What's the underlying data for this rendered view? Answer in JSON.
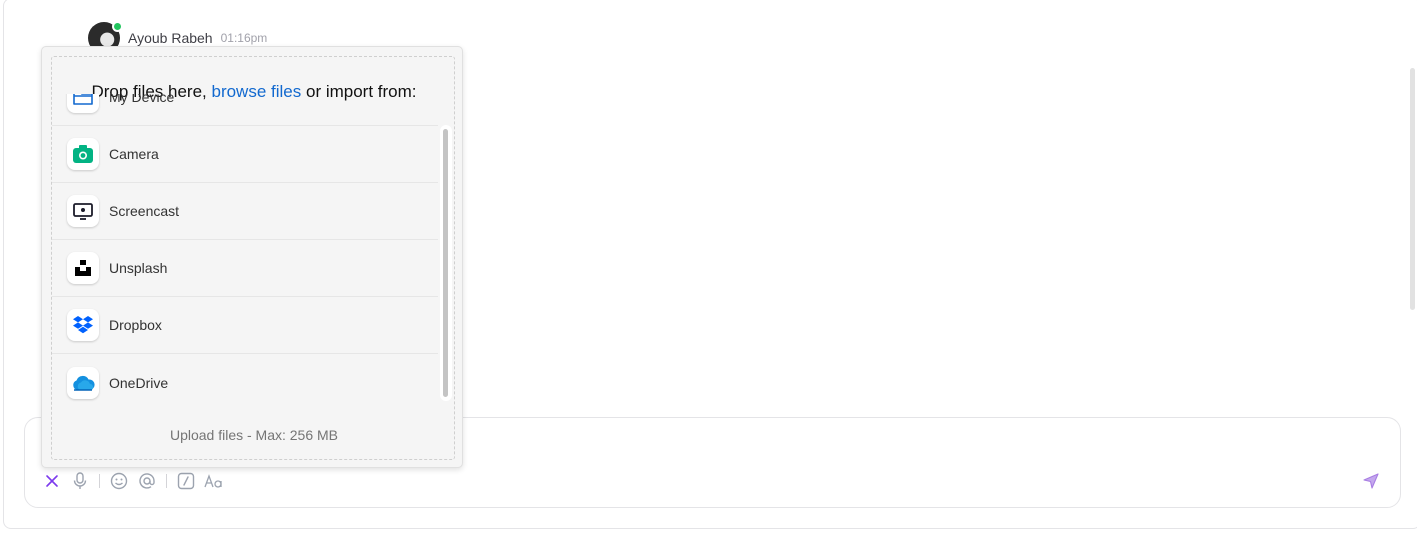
{
  "message": {
    "author": "Ayoub Rabeh",
    "time": "01:16pm"
  },
  "uploader": {
    "title_prefix": "Drop files here,",
    "browse_link": "browse files",
    "title_suffix": "or import from:",
    "sources": [
      {
        "label": "My Device",
        "icon": "folder-icon",
        "color": "#1269cf"
      },
      {
        "label": "Camera",
        "icon": "camera-icon",
        "color": "#02b383"
      },
      {
        "label": "Screencast",
        "icon": "screencast-icon",
        "color": "#1c1c2a"
      },
      {
        "label": "Unsplash",
        "icon": "unsplash-icon",
        "color": "#000000"
      },
      {
        "label": "Dropbox",
        "icon": "dropbox-icon",
        "color": "#0061fe"
      },
      {
        "label": "OneDrive",
        "icon": "onedrive-icon",
        "color": "#0364b8"
      }
    ],
    "note": "Upload files - Max: 256 MB"
  },
  "composer": {
    "tools": [
      "close-icon",
      "microphone-icon",
      "emoji-icon",
      "mention-icon",
      "slash-command-icon",
      "text-format-icon"
    ],
    "send_icon": "send-icon",
    "accent": "#9b51e0"
  }
}
